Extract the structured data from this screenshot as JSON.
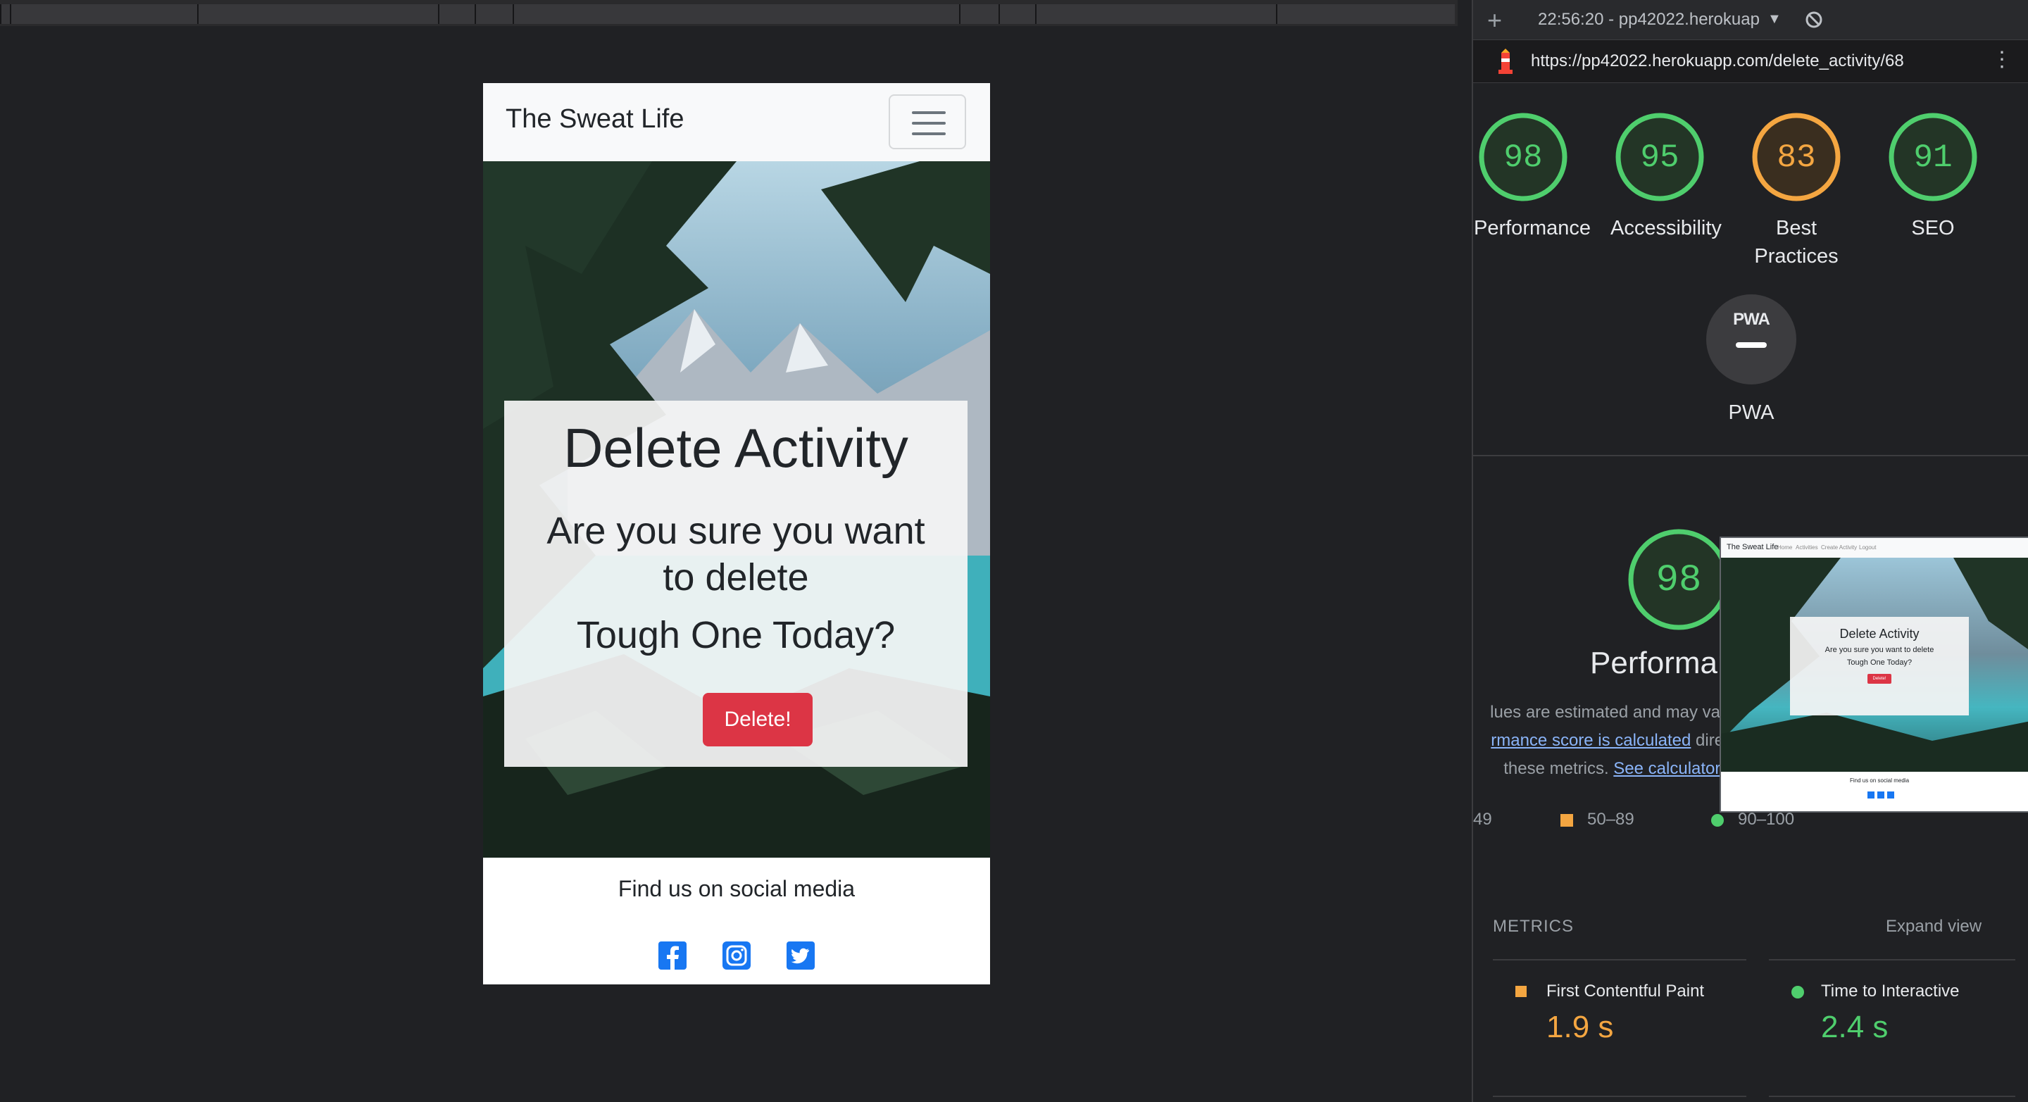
{
  "site": {
    "brand": "The Sweat Life",
    "card_title": "Delete Activity",
    "question_line": "Are you sure you want to delete",
    "activity_line": "Tough One Today?",
    "delete_button": "Delete!",
    "footer_text": "Find us on social media",
    "social_icons": [
      "facebook-icon",
      "instagram-icon",
      "twitter-icon"
    ]
  },
  "lighthouse": {
    "report_time": "22:56:20 - pp42022.herokuap",
    "url": "https://pp42022.herokuapp.com/delete_activity/68",
    "scores": [
      {
        "label": "Performance",
        "value": "98",
        "color": "#4fce6d"
      },
      {
        "label": "Accessibility",
        "value": "95",
        "color": "#4fce6d"
      },
      {
        "label": "Best Practices",
        "value": "83",
        "color": "#f4a641"
      },
      {
        "label": "SEO",
        "value": "91",
        "color": "#4fce6d"
      }
    ],
    "pwa_badge": "PWA",
    "pwa_label": "PWA",
    "performance": {
      "score": "98",
      "title": "Performance",
      "desc_line1": "lues are estimated and may vary.",
      "desc_link1": "rmance score is calculated",
      "desc_line2_rest": " direct",
      "desc_line3": "these metrics. ",
      "desc_link2": "See calculator."
    },
    "legend": {
      "low": "49",
      "mid": "50–89",
      "high": "90–100"
    },
    "thumbnail": {
      "brand": "The Sweat Life",
      "nav": [
        "Home",
        "Activities",
        "Create Activity",
        "Logout"
      ],
      "title": "Delete Activity",
      "question": "Are you sure you want to delete",
      "activity": "Tough One Today?",
      "button": "Delete!",
      "footer": "Find us on social media"
    },
    "metrics_header": "METRICS",
    "expand_view": "Expand view",
    "metrics": [
      {
        "name": "First Contentful Paint",
        "value": "1.9 s",
        "color": "#f4a641"
      },
      {
        "name": "Time to Interactive",
        "value": "2.4 s",
        "color": "#4fce6d"
      }
    ]
  }
}
